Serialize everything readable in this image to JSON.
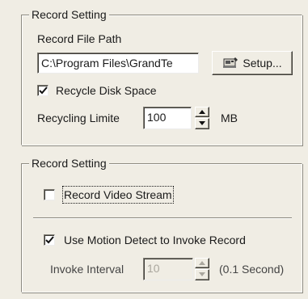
{
  "record_setting_1": {
    "title": "Record Setting",
    "file_path_label": "Record File Path",
    "file_path_value": "C:\\Program Files\\GrandTe",
    "setup_button": "Setup...",
    "recycle_checkbox_label": "Recycle Disk Space",
    "recycle_checked": true,
    "recycling_limit_label": "Recycling Limite",
    "recycling_limit_value": "100",
    "recycling_limit_unit": "MB"
  },
  "record_setting_2": {
    "title": "Record Setting",
    "video_stream_label": "Record Video Stream",
    "video_stream_checked": false,
    "motion_detect_label": "Use Motion Detect to Invoke Record",
    "motion_detect_checked": true,
    "invoke_interval_label": "Invoke Interval",
    "invoke_interval_value": "10",
    "invoke_interval_unit": "(0.1 Second)"
  }
}
